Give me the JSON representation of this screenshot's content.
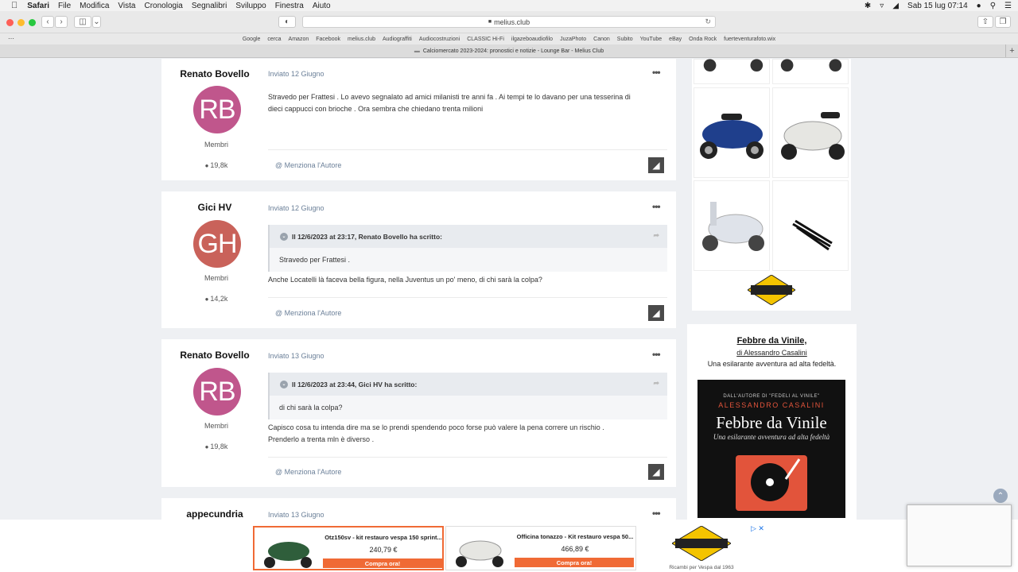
{
  "menubar": {
    "apple": "",
    "items": [
      "Safari",
      "File",
      "Modifica",
      "Vista",
      "Cronologia",
      "Segnalibri",
      "Sviluppo",
      "Finestra",
      "Aiuto"
    ],
    "clock": "Sab 15 lug  07:14"
  },
  "browser": {
    "url": "melius.club",
    "favorites": [
      "Google",
      "cerca",
      "Amazon",
      "Facebook",
      "melius.club",
      "Audiograffiti",
      "Audiocostruzioni",
      "CLASSIC Hi-Fi",
      "ilgazeboaudiofilo",
      "JuzaPhoto",
      "Canon",
      "Subito",
      "YouTube",
      "eBay",
      "Onda Rock",
      "fuerteventurafoto.wix"
    ],
    "tab_title": "Calciomercato 2023-2024: pronostici e notizie - Lounge Bar - Melius Club"
  },
  "posts": [
    {
      "author": "Renato Bovello",
      "initials": "RB",
      "avatar_color": "#c0568c",
      "role": "Membri",
      "count": "19,8k",
      "date": "Inviato 12 Giugno",
      "text_lines": [
        "Stravedo per Frattesi . Lo avevo segnalato ad amici milanisti tre anni fa . Ai tempi te lo davano per una tesserina di",
        "dieci cappucci con brioche . Ora sembra che chiedano trenta milioni"
      ],
      "mention": "Menziona l'Autore"
    },
    {
      "author": "Gici HV",
      "initials": "GH",
      "avatar_color": "#c9625a",
      "role": "Membri",
      "count": "14,2k",
      "date": "Inviato 12 Giugno",
      "quote_header": "Il 12/6/2023 at 23:17, Renato Bovello ha scritto:",
      "quote_body": "Stravedo per Frattesi .",
      "text_lines": [
        "Anche Locatelli là faceva bella figura, nella Juventus un po' meno, di chi sarà la colpa?"
      ],
      "mention": "Menziona l'Autore"
    },
    {
      "author": "Renato Bovello",
      "initials": "RB",
      "avatar_color": "#c0568c",
      "role": "Membri",
      "count": "19,8k",
      "date": "Inviato 13 Giugno",
      "quote_header": "Il 12/6/2023 at 23:44, Gici HV ha scritto:",
      "quote_body": "di chi sarà la colpa?",
      "text_lines": [
        "Capisco cosa tu intenda dire ma se lo prendi spendendo poco forse può valere la pena correre un rischio .",
        "Prenderlo a trenta mln è diverso ."
      ],
      "mention": "Menziona l'Autore"
    },
    {
      "author": "appecundria",
      "date": "Inviato 13 Giugno"
    }
  ],
  "sidebar": {
    "logo_text": "OFFICINA TONAZZO",
    "book_title": "Febbre da Vinile,",
    "book_author": "di Alessandro Casalini",
    "book_tagline": "Una esilarante avventura ad alta fedeltà.",
    "cover": {
      "small": "DALL'AUTORE DI \"FEDELI AL VINILE\"",
      "author": "ALESSANDRO CASALINI",
      "title": "Febbre da Vinile",
      "subtitle": "Una esilarante avventura ad alta fedeltà"
    }
  },
  "ads": {
    "items": [
      {
        "name": "Otz150sv - kit restauro vespa 150 sprint...",
        "price": "240,79 €",
        "cta": "Compra ora!"
      },
      {
        "name": "Officina tonazzo - Kit restauro vespa 50...",
        "price": "466,89 €",
        "cta": "Compra ora!"
      }
    ],
    "caption": "Ricambi per Vespa dal 1963"
  },
  "colors": {
    "link": "#6a7f98",
    "accent": "#f06a35"
  }
}
